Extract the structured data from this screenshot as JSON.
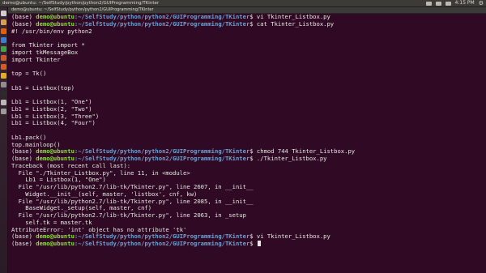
{
  "topbar": {
    "window_title": "demo@ubuntu: ~/SelfStudy/python/python2/GUIProgramming/TKinter",
    "clock": "4:15 PM"
  },
  "terminal": {
    "title": "demo@ubuntu: ~/SelfStudy/python/python2/GUIProgramming/TKinter",
    "lines": [
      {
        "env": "(base) ",
        "user": "demo@ubuntu",
        "cwd": ":~/SelfStudy/python/python2/GUIProgramming/TKinter",
        "cmd": "$ vi Tkinter_Listbox.py"
      },
      {
        "env": "(base) ",
        "user": "demo@ubuntu",
        "cwd": ":~/SelfStudy/python/python2/GUIProgramming/TKinter",
        "cmd": "$ cat Tkinter_Listbox.py"
      },
      {
        "text": "#! /usr/bin/env python2"
      },
      {
        "text": ""
      },
      {
        "text": "from Tkinter import *"
      },
      {
        "text": "import tkMessageBox"
      },
      {
        "text": "import Tkinter"
      },
      {
        "text": ""
      },
      {
        "text": "top = Tk()"
      },
      {
        "text": ""
      },
      {
        "text": "Lb1 = Listbox(top)"
      },
      {
        "text": ""
      },
      {
        "text": "Lb1 = Listbox(1, \"One\")"
      },
      {
        "text": "Lb1 = Listbox(2, \"Two\")"
      },
      {
        "text": "Lb1 = Listbox(3, \"Three\")"
      },
      {
        "text": "Lb1 = Listbox(4, \"Four\")"
      },
      {
        "text": ""
      },
      {
        "text": "Lb1.pack()"
      },
      {
        "text": "top.mainloop()"
      },
      {
        "env": "(base) ",
        "user": "demo@ubuntu",
        "cwd": ":~/SelfStudy/python/python2/GUIProgramming/TKinter",
        "cmd": "$ chmod 744 Tkinter_Listbox.py"
      },
      {
        "env": "(base) ",
        "user": "demo@ubuntu",
        "cwd": ":~/SelfStudy/python/python2/GUIProgramming/TKinter",
        "cmd": "$ ./Tkinter_Listbox.py"
      },
      {
        "text": "Traceback (most recent call last):"
      },
      {
        "text": "  File \"./Tkinter_Listbox.py\", line 11, in <module>"
      },
      {
        "text": "    Lb1 = Listbox(1, \"One\")"
      },
      {
        "text": "  File \"/usr/lib/python2.7/lib-tk/Tkinter.py\", line 2607, in __init__"
      },
      {
        "text": "    Widget.__init__(self, master, 'listbox', cnf, kw)"
      },
      {
        "text": "  File \"/usr/lib/python2.7/lib-tk/Tkinter.py\", line 2085, in __init__"
      },
      {
        "text": "    BaseWidget._setup(self, master, cnf)"
      },
      {
        "text": "  File \"/usr/lib/python2.7/lib-tk/Tkinter.py\", line 2063, in _setup"
      },
      {
        "text": "    self.tk = master.tk"
      },
      {
        "text": "AttributeError: 'int' object has no attribute 'tk'"
      },
      {
        "env": "(base) ",
        "user": "demo@ubuntu",
        "cwd": ":~/SelfStudy/python/python2/GUIProgramming/TKinter",
        "cmd": "$ vi Tkinter_Listbox.py"
      },
      {
        "env": "(base) ",
        "user": "demo@ubuntu",
        "cwd": ":~/SelfStudy/python/python2/GUIProgramming/TKinter",
        "cmd": "$ ",
        "cursor": true
      }
    ]
  },
  "launcher": {
    "icons": [
      {
        "name": "dash-icon",
        "color": "#cfcfcf"
      },
      {
        "name": "files-icon",
        "color": "#d9a04a"
      },
      {
        "name": "firefox-icon",
        "color": "#e66000"
      },
      {
        "name": "libreoffice-writer-icon",
        "color": "#3a7fd4"
      },
      {
        "name": "libreoffice-calc-icon",
        "color": "#3da544"
      },
      {
        "name": "libreoffice-impress-icon",
        "color": "#d1572a"
      },
      {
        "name": "software-center-icon",
        "color": "#dd5a1e"
      },
      {
        "name": "amazon-icon",
        "color": "#e5ae1e"
      },
      {
        "name": "settings-icon",
        "color": "#8e8e8e"
      },
      {
        "name": "terminal-icon",
        "color": "#2b2b2b"
      },
      {
        "name": "text-editor-icon",
        "color": "#b8b8b8"
      },
      {
        "name": "trash-icon",
        "color": "#9a9a9a"
      }
    ]
  }
}
